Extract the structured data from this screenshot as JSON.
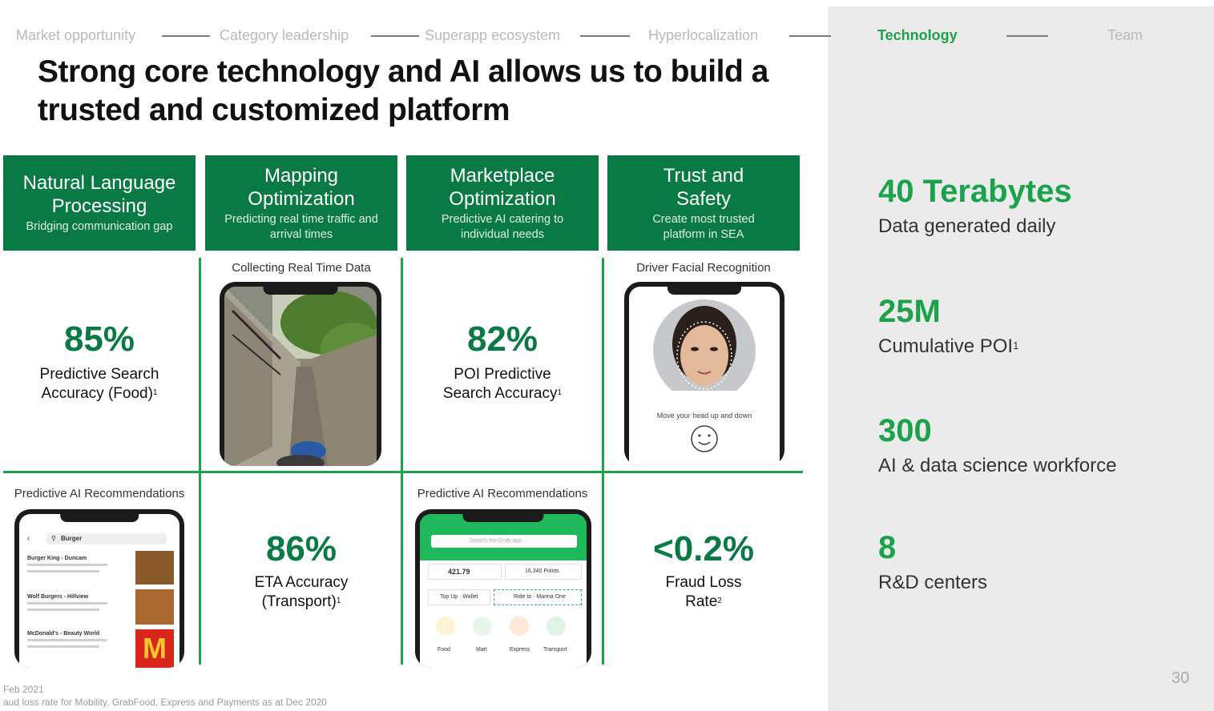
{
  "nav": {
    "items": [
      "Market opportunity",
      "Category leadership",
      "Superapp ecosystem",
      "Hyperlocalization",
      "Technology",
      "Team"
    ],
    "active": "Technology"
  },
  "title": {
    "line1": "Strong core technology and AI allows us to build a",
    "line2": "trusted and customized platform"
  },
  "pillars": [
    {
      "title": "Natural Language Processing",
      "subtitle": "Bridging communication gap"
    },
    {
      "title": "Mapping Optimization",
      "subtitle": "Predicting real time traffic and arrival times"
    },
    {
      "title": "Marketplace Optimization",
      "subtitle": "Predictive AI catering to individual needs"
    },
    {
      "title": "Trust and Safety",
      "subtitle": "Create most trusted platform in SEA"
    }
  ],
  "cells": {
    "nlp_stat": {
      "value": "85%",
      "label1": "Predictive Search",
      "label2": "Accuracy (Food)",
      "sup": "1"
    },
    "map_caption": "Collecting Real Time Data",
    "market_stat": {
      "value": "82%",
      "label1": "POI Predictive",
      "label2": "Search Accuracy",
      "sup": "1"
    },
    "trust_caption": "Driver Facial Recognition",
    "trust_screen_text": "Move your head up and down",
    "nlp_caption2": "Predictive AI Recommendations",
    "eta_stat": {
      "value": "86%",
      "label1": "ETA Accuracy",
      "label2": "(Transport)",
      "sup": "1"
    },
    "market_caption2": "Predictive AI Recommendations",
    "fraud_stat": {
      "value": "<0.2%",
      "label1": "Fraud Loss",
      "label2": "Rate",
      "sup": "2"
    }
  },
  "food_app": {
    "search": "Burger",
    "rows": [
      "Burger King - Duncam",
      "Wolf Burgers - Hillview",
      "McDonald's - Beauty World"
    ]
  },
  "grab_app": {
    "search_placeholder": "Search the Grab app",
    "balance": "421.79",
    "points": "16,340 Points",
    "topup": "Top Up · Wallet",
    "ride": "Ride to · Marina One",
    "services": [
      "Food",
      "Mart",
      "Express",
      "Transport"
    ]
  },
  "metrics": [
    {
      "value": "40 Terabytes",
      "desc": "Data generated daily",
      "sup": ""
    },
    {
      "value": "25M",
      "desc": "Cumulative POI",
      "sup": "1"
    },
    {
      "value": "300",
      "desc": "AI & data science workforce",
      "sup": ""
    },
    {
      "value": "8",
      "desc": "R&D centers",
      "sup": ""
    }
  ],
  "page_number": "30",
  "footnotes": {
    "line1": "Feb 2021",
    "line2": "aud loss rate for Mobility, GrabFood, Express and Payments as at Dec 2020"
  },
  "colors": {
    "brand_green": "#0a7a44",
    "accent_green": "#1aa34a",
    "panel_gray": "#ebebeb"
  }
}
